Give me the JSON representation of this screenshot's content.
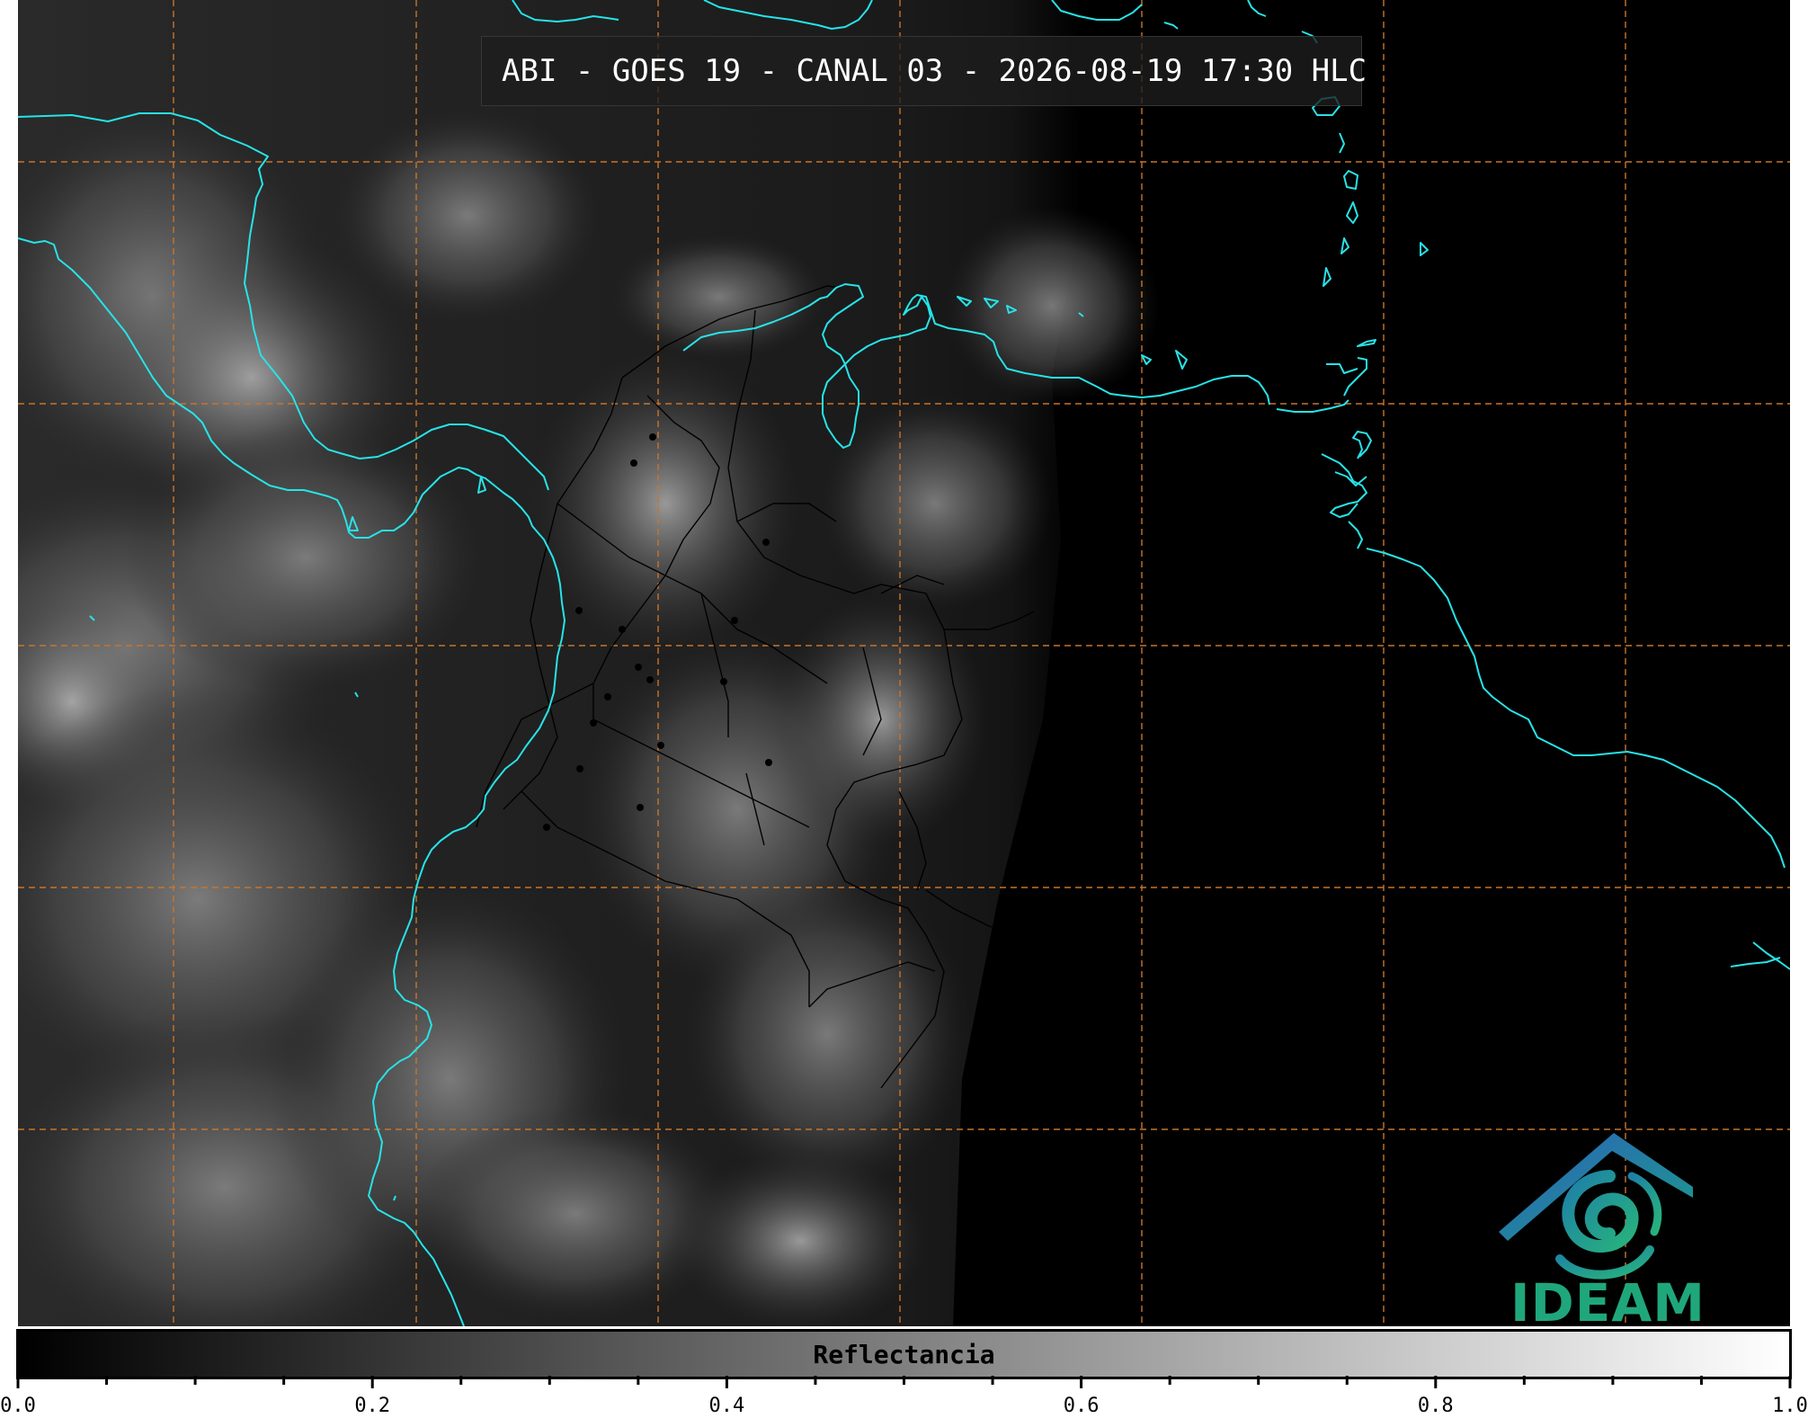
{
  "title": "ABI - GOES 19 - CANAL 03 - 2026-08-19 17:30 HLC",
  "colorbar": {
    "label": "Reflectancia",
    "min": 0.0,
    "max": 1.0,
    "major_ticks": [
      "0.0",
      "0.2",
      "0.4",
      "0.6",
      "0.8",
      "1.0"
    ],
    "major_values": [
      0.0,
      0.2,
      0.4,
      0.6,
      0.8,
      1.0
    ],
    "minor_step": 0.05
  },
  "logo": {
    "word": "IDEAM",
    "colors": {
      "roof": "#2a6db5",
      "spiral": "#1fa77b"
    }
  },
  "colors": {
    "coastline": "#27e3e8",
    "gridline": "#c8742a",
    "borders": "#000000",
    "background_ocean": "#151515",
    "night_side": "#000000"
  }
}
